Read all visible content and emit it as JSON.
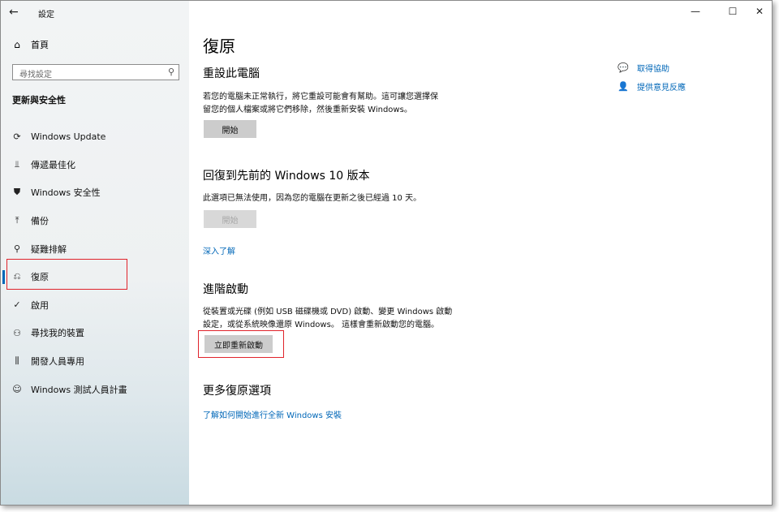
{
  "window": {
    "app_title": "設定",
    "back_icon": "arrow-left-icon",
    "controls": {
      "minimize": "—",
      "maximize": "☐",
      "close": "✕"
    }
  },
  "sidebar": {
    "home_label": "首頁",
    "search_placeholder": "尋找設定",
    "section_title": "更新與安全性",
    "items": [
      {
        "label": "Windows Update",
        "icon": "sync-icon",
        "glyph": "⟳",
        "active": false
      },
      {
        "label": "傳遞最佳化",
        "icon": "delivery-optimization-icon",
        "glyph": "⫫",
        "active": false
      },
      {
        "label": "Windows 安全性",
        "icon": "shield-icon",
        "glyph": "⛊",
        "active": false
      },
      {
        "label": "備份",
        "icon": "backup-arrow-icon",
        "glyph": "⤒",
        "active": false
      },
      {
        "label": "疑難排解",
        "icon": "wrench-icon",
        "glyph": "⚲",
        "active": false
      },
      {
        "label": "復原",
        "icon": "recovery-icon",
        "glyph": "⎌",
        "active": true
      },
      {
        "label": "啟用",
        "icon": "activation-check-icon",
        "glyph": "✓",
        "active": false
      },
      {
        "label": "尋找我的裝置",
        "icon": "find-device-icon",
        "glyph": "⚇",
        "active": false
      },
      {
        "label": "開發人員專用",
        "icon": "developer-icon",
        "glyph": "⫼",
        "active": false
      },
      {
        "label": "Windows 測試人員計畫",
        "icon": "insider-icon",
        "glyph": "☺",
        "active": false
      }
    ]
  },
  "main": {
    "title": "復原",
    "reset": {
      "heading": "重設此電腦",
      "desc_line1": "若您的電腦未正常執行，將它重設可能會有幫助。這可讓您選擇保",
      "desc_line2": "留您的個人檔案或將它們移除，然後重新安裝 Windows。",
      "button": "開始"
    },
    "go_back": {
      "heading": "回復到先前的 Windows 10 版本",
      "desc": "此選項已無法使用，因為您的電腦在更新之後已經過 10 天。",
      "button": "開始",
      "link": "深入了解"
    },
    "advanced": {
      "heading": "進階啟動",
      "desc_line1": "從裝置或光碟 (例如 USB 磁碟機或 DVD) 啟動、變更 Windows 啟動",
      "desc_line2": "設定，或從系統映像還原 Windows。 這樣會重新啟動您的電腦。",
      "button": "立即重新啟動"
    },
    "more": {
      "heading": "更多復原選項",
      "link": "了解如何開始進行全新 Windows 安裝"
    }
  },
  "help": {
    "get_help": "取得協助",
    "feedback": "提供意見反應"
  },
  "colors": {
    "accent": "#0067b8",
    "highlight_box": "#e0232b",
    "button_bg": "#cccccc"
  }
}
